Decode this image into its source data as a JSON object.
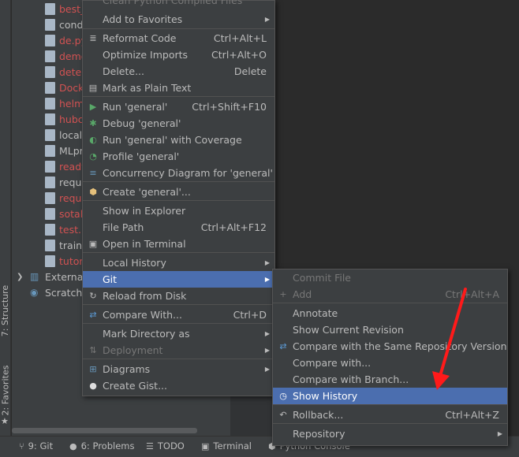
{
  "tool_windows": {
    "structure_label": "7: Structure",
    "favorites_label": "2: Favorites"
  },
  "project_tree": {
    "files": [
      {
        "name": "best_",
        "type": "csv",
        "color": "#d25252"
      },
      {
        "name": "cond",
        "type": "yml",
        "color": "#bbbbbb"
      },
      {
        "name": "de.py",
        "type": "py",
        "color": "#d25252"
      },
      {
        "name": "demo",
        "type": "py",
        "color": "#d25252"
      },
      {
        "name": "detec",
        "type": "py",
        "color": "#d25252"
      },
      {
        "name": "Dock",
        "type": "file",
        "color": "#d25252"
      },
      {
        "name": "helm",
        "type": "yml",
        "color": "#d25252"
      },
      {
        "name": "hubc",
        "type": "yml",
        "color": "#d25252"
      },
      {
        "name": "local_",
        "type": "sh",
        "color": "#bbbbbb"
      },
      {
        "name": "MLpr",
        "type": "file",
        "color": "#bbbbbb"
      },
      {
        "name": "ready",
        "type": "py",
        "color": "#d25252"
      },
      {
        "name": "requi",
        "type": "file",
        "color": "#bbbbbb"
      },
      {
        "name": "requi",
        "type": "file",
        "color": "#d25252"
      },
      {
        "name": "sotab",
        "type": "py",
        "color": "#d25252"
      },
      {
        "name": "test.p",
        "type": "py",
        "color": "#d25252"
      },
      {
        "name": "train.",
        "type": "py",
        "color": "#bbbbbb"
      },
      {
        "name": "tutori",
        "type": "ipy",
        "color": "#d25252"
      }
    ],
    "external": "External",
    "scratches": "Scratche"
  },
  "main_menu": {
    "top_cut_label": "Clean Python Compiled Files",
    "items": [
      {
        "label": "Add to Favorites",
        "shortcut": "",
        "submenu": true,
        "icon": "",
        "icon_name": ""
      },
      {
        "label": "Reformat Code",
        "shortcut": "Ctrl+Alt+L",
        "submenu": false,
        "icon": "≣",
        "icon_name": "reformat-code-icon"
      },
      {
        "label": "Optimize Imports",
        "shortcut": "Ctrl+Alt+O",
        "submenu": false,
        "icon": "",
        "icon_name": ""
      },
      {
        "label": "Delete...",
        "shortcut": "Delete",
        "submenu": false,
        "icon": "",
        "icon_name": ""
      },
      {
        "label": "Mark as Plain Text",
        "shortcut": "",
        "submenu": false,
        "icon": "▤",
        "icon_name": "plain-text-icon"
      },
      {
        "label": "Run 'general'",
        "shortcut": "Ctrl+Shift+F10",
        "submenu": false,
        "icon": "▶",
        "icon_name": "run-icon"
      },
      {
        "label": "Debug 'general'",
        "shortcut": "",
        "submenu": false,
        "icon": "✱",
        "icon_name": "debug-icon"
      },
      {
        "label": "Run 'general' with Coverage",
        "shortcut": "",
        "submenu": false,
        "icon": "◐",
        "icon_name": "coverage-icon"
      },
      {
        "label": "Profile 'general'",
        "shortcut": "",
        "submenu": false,
        "icon": "◔",
        "icon_name": "profile-icon"
      },
      {
        "label": "Concurrency Diagram for 'general'",
        "shortcut": "",
        "submenu": false,
        "icon": "≡",
        "icon_name": "concurrency-icon"
      },
      {
        "label": "Create 'general'...",
        "shortcut": "",
        "submenu": false,
        "icon": "⬢",
        "icon_name": "python-icon"
      },
      {
        "label": "Show in Explorer",
        "shortcut": "",
        "submenu": false,
        "icon": "",
        "icon_name": ""
      },
      {
        "label": "File Path",
        "shortcut": "Ctrl+Alt+F12",
        "submenu": false,
        "icon": "",
        "icon_name": ""
      },
      {
        "label": "Open in Terminal",
        "shortcut": "",
        "submenu": false,
        "icon": "▣",
        "icon_name": "terminal-icon"
      },
      {
        "label": "Local History",
        "shortcut": "",
        "submenu": true,
        "icon": "",
        "icon_name": ""
      },
      {
        "label": "Git",
        "shortcut": "",
        "submenu": true,
        "icon": "",
        "icon_name": ""
      },
      {
        "label": "Reload from Disk",
        "shortcut": "",
        "submenu": false,
        "icon": "↻",
        "icon_name": "reload-icon"
      },
      {
        "label": "Compare With...",
        "shortcut": "Ctrl+D",
        "submenu": false,
        "icon": "⇄",
        "icon_name": "compare-icon"
      },
      {
        "label": "Mark Directory as",
        "shortcut": "",
        "submenu": true,
        "icon": "",
        "icon_name": ""
      },
      {
        "label": "Deployment",
        "shortcut": "",
        "submenu": true,
        "icon": "⇅",
        "icon_name": "deployment-icon"
      },
      {
        "label": "Diagrams",
        "shortcut": "",
        "submenu": true,
        "icon": "⊞",
        "icon_name": "diagrams-icon"
      },
      {
        "label": "Create Gist...",
        "shortcut": "",
        "submenu": false,
        "icon": "●",
        "icon_name": "github-icon"
      }
    ]
  },
  "git_menu": {
    "items": [
      {
        "label": "Commit File",
        "shortcut": "",
        "submenu": false,
        "icon": "",
        "icon_name": ""
      },
      {
        "label": "Add",
        "shortcut": "Ctrl+Alt+A",
        "submenu": false,
        "icon": "+",
        "icon_name": "add-icon"
      },
      {
        "label": "Annotate",
        "shortcut": "",
        "submenu": false,
        "icon": "",
        "icon_name": ""
      },
      {
        "label": "Show Current Revision",
        "shortcut": "",
        "submenu": false,
        "icon": "",
        "icon_name": ""
      },
      {
        "label": "Compare with the Same Repository Version",
        "shortcut": "",
        "submenu": false,
        "icon": "⇄",
        "icon_name": "compare-icon"
      },
      {
        "label": "Compare with...",
        "shortcut": "",
        "submenu": false,
        "icon": "",
        "icon_name": ""
      },
      {
        "label": "Compare with Branch...",
        "shortcut": "",
        "submenu": false,
        "icon": "",
        "icon_name": ""
      },
      {
        "label": "Show History",
        "shortcut": "",
        "submenu": false,
        "icon": "◷",
        "icon_name": "history-icon"
      },
      {
        "label": "Rollback...",
        "shortcut": "Ctrl+Alt+Z",
        "submenu": false,
        "icon": "↶",
        "icon_name": "rollback-icon"
      },
      {
        "label": "Repository",
        "shortcut": "",
        "submenu": true,
        "icon": "",
        "icon_name": ""
      }
    ]
  },
  "bottom_bar": {
    "git": "9: Git",
    "problems": "6: Problems",
    "todo": "TODO",
    "terminal": "Terminal",
    "python_console": "Python Console"
  },
  "colors": {
    "selection": "#4b6eaf",
    "annotation": "#ff1a1a"
  }
}
